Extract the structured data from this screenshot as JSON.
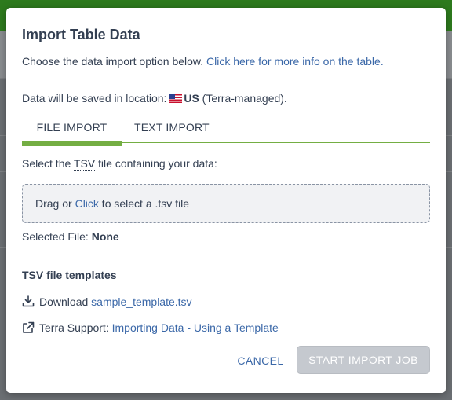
{
  "modal": {
    "title": "Import Table Data",
    "intro_text": "Choose the data import option below. ",
    "intro_link": "Click here for more info on the table.",
    "location_prefix": "Data will be saved in location: ",
    "location_flag": "us-flag-icon",
    "location_region": "US",
    "location_suffix": " (Terra-managed)."
  },
  "tabs": [
    {
      "label": "FILE IMPORT",
      "selected": true
    },
    {
      "label": "TEXT IMPORT",
      "selected": false
    }
  ],
  "file_import": {
    "select_prefix": "Select the ",
    "select_abbr": "TSV",
    "select_suffix": " file containing your data:",
    "dropzone_prefix": "Drag or ",
    "dropzone_link": "Click",
    "dropzone_suffix": " to select a .tsv file",
    "selected_label": "Selected File: ",
    "selected_value": "None"
  },
  "templates": {
    "title": "TSV file templates",
    "download_label": "Download ",
    "download_link": "sample_template.tsv",
    "download_icon": "download-icon",
    "support_label": "Terra Support: ",
    "support_link": "Importing Data - Using a Template",
    "support_icon": "external-link-icon"
  },
  "actions": {
    "cancel_label": "CANCEL",
    "start_label": "START IMPORT JOB",
    "start_disabled": true
  },
  "colors": {
    "brand_green": "#74ae43",
    "link_blue": "#3b68a8",
    "text": "#333f52",
    "disabled_button": "#c5c9cf"
  }
}
